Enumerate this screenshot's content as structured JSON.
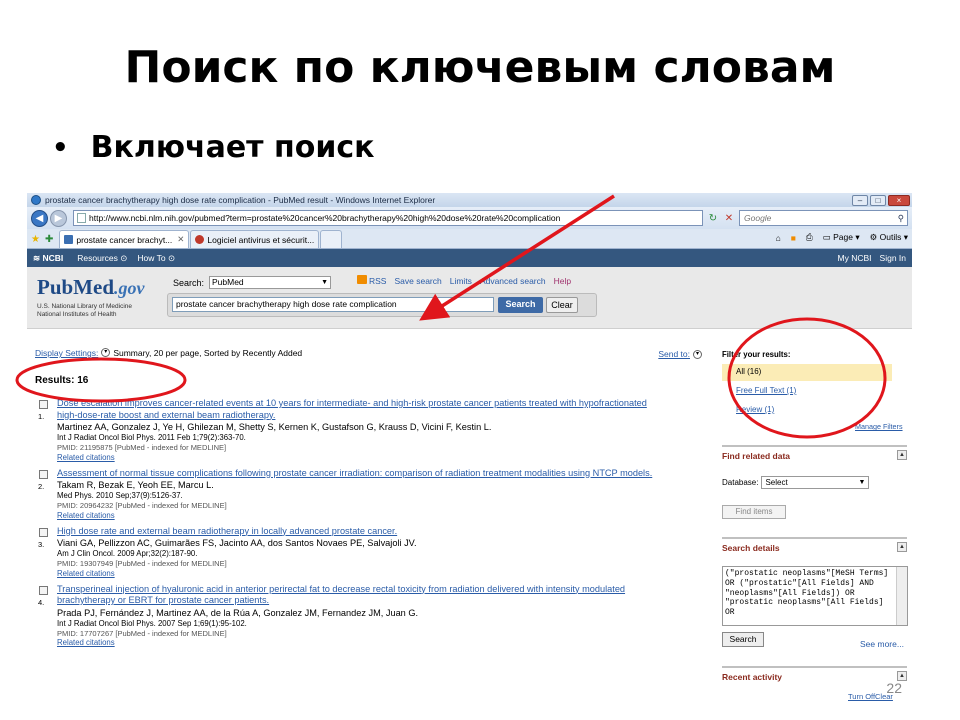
{
  "slide": {
    "title": "Поиск по ключевым словам",
    "bullet": "Включает поиск",
    "page_number": "22"
  },
  "browser": {
    "window_title": "prostate cancer brachytherapy high dose rate complication - PubMed result - Windows Internet Explorer",
    "url": "http://www.ncbi.nlm.nih.gov/pubmed?term=prostate%20cancer%20brachytherapy%20high%20dose%20rate%20complication",
    "search_engine_placeholder": "Google",
    "tabs": [
      {
        "label": "prostate cancer brachyt...",
        "active": true
      },
      {
        "label": "Logiciel antivirus et sécurit...",
        "active": false
      }
    ],
    "command_bar": {
      "page": "Page",
      "tools": "Outils"
    }
  },
  "ncbi": {
    "logo": "NCBI",
    "resources": "Resources",
    "howto": "How To",
    "my_ncbi": "My NCBI",
    "sign_in": "Sign In"
  },
  "pubmed": {
    "logo_main": "PubMed",
    "logo_gov": ".gov",
    "sub1": "U.S. National Library of Medicine",
    "sub2": "National Institutes of Health",
    "search_label": "Search:",
    "database": "PubMed",
    "links": {
      "rss": "RSS",
      "save": "Save search",
      "limits": "Limits",
      "advanced": "Advanced search",
      "help": "Help"
    },
    "query": "prostate cancer brachytherapy high dose rate complication",
    "search_button": "Search",
    "clear_button": "Clear"
  },
  "display": {
    "settings_label": "Display Settings:",
    "settings_value": "Summary, 20 per page, Sorted by Recently Added",
    "send_to": "Send to:"
  },
  "results": {
    "count_label": "Results: 16",
    "items": [
      {
        "num": "1.",
        "title_l1": "Dose escalation improves cancer-related events at 10 years for intermediate- and high-risk prostate cancer patients treated with hypofractionated",
        "title_l2": "high-dose-rate boost and external beam radiotherapy.",
        "authors": "Martinez AA, Gonzalez J, Ye H, Ghilezan M, Shetty S, Kernen K, Gustafson G, Krauss D, Vicini F, Kestin L.",
        "journal": "Int J Radiat Oncol Biol Phys. 2011 Feb 1;79(2):363-70.",
        "pmid": "PMID: 21195875 [PubMed - indexed for MEDLINE]",
        "related": "Related citations"
      },
      {
        "num": "2.",
        "title_l1": "Assessment of normal tissue complications following prostate cancer irradiation: comparison of radiation treatment modalities using NTCP models.",
        "title_l2": "",
        "authors": "Takam R, Bezak E, Yeoh EE, Marcu L.",
        "journal": "Med Phys. 2010 Sep;37(9):5126-37.",
        "pmid": "PMID: 20964232 [PubMed - indexed for MEDLINE]",
        "related": "Related citations"
      },
      {
        "num": "3.",
        "title_l1": "High dose rate and external beam radiotherapy in locally advanced prostate cancer.",
        "title_l2": "",
        "authors": "Viani GA, Pellizzon AC, Guimarães FS, Jacinto AA, dos Santos Novaes PE, Salvajoli JV.",
        "journal": "Am J Clin Oncol. 2009 Apr;32(2):187-90.",
        "pmid": "PMID: 19307949 [PubMed - indexed for MEDLINE]",
        "related": "Related citations"
      },
      {
        "num": "4.",
        "title_l1": "Transperineal injection of hyaluronic acid in anterior perirectal fat to decrease rectal toxicity from radiation delivered with intensity modulated",
        "title_l2": "brachytherapy or EBRT for prostate cancer patients.",
        "authors": "Prada PJ, Fernández J, Martinez AA, de la Rúa A, Gonzalez JM, Fernandez JM, Juan G.",
        "journal": "Int J Radiat Oncol Biol Phys. 2007 Sep 1;69(1):95-102.",
        "pmid": "PMID: 17707267 [PubMed - indexed for MEDLINE]",
        "related": "Related citations"
      }
    ]
  },
  "sidebar": {
    "filter_title": "Filter your results:",
    "filter_all": "All (16)",
    "filter_free": "Free Full Text (1)",
    "filter_review": "Review (1)",
    "manage_filters": "Manage Filters",
    "find_related_title": "Find related data",
    "database_label": "Database:",
    "database_value": "Select",
    "find_items": "Find items",
    "search_details_title": "Search details",
    "search_details_text": "(\"prostatic neoplasms\"[MeSH Terms] OR (\"prostatic\"[All Fields] AND \"neoplasms\"[All Fields]) OR \"prostatic neoplasms\"[All Fields] OR",
    "search_button": "Search",
    "see_more": "See more...",
    "recent_title": "Recent activity",
    "turn_off": "Turn Off",
    "clear": "Clear"
  },
  "colors": {
    "annotation": "#e0161c",
    "ncbi_bar": "#34577f",
    "link": "#2a5ca8"
  }
}
